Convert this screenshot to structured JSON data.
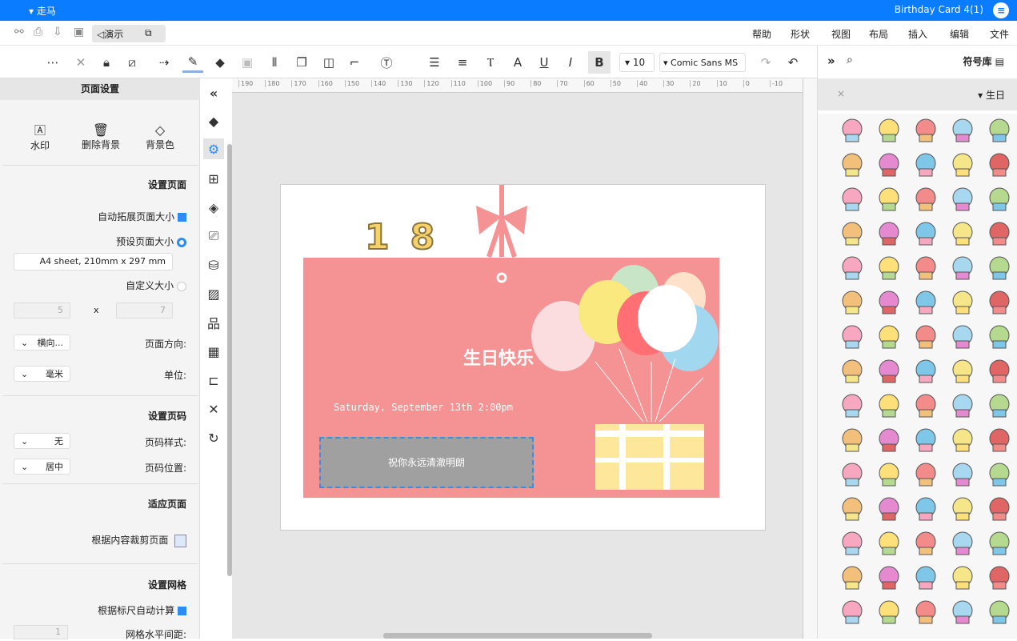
{
  "titlebar": {
    "title": "Birthday Card 4(1)",
    "user": "走马"
  },
  "menu": [
    "文件",
    "编辑",
    "插入",
    "布局",
    "视图",
    "形状",
    "帮助"
  ],
  "quick": {
    "present": "演示"
  },
  "toolbar": {
    "font": "Comic Sans MS",
    "size": "10",
    "bold": "B",
    "italic": "I",
    "underline": "U",
    "color": "A"
  },
  "left_panel": {
    "title": "页面设置",
    "actions": [
      "背景色",
      "删除背景",
      "水印"
    ],
    "page_section": "设置页面",
    "auto_extend": "自动拓展页面大小",
    "preset_size": "预设页面大小",
    "preset_value": "A4 sheet, 210mm x 297 mm",
    "custom_size": "自定义大小",
    "width": "7",
    "height": "5",
    "x": "x",
    "orientation_label": "页面方向:",
    "orientation": "横向...",
    "unit_label": "单位:",
    "unit": "毫米",
    "pagenum_section": "设置页码",
    "pagenum_style_label": "页码样式:",
    "pagenum_style": "无",
    "pagenum_pos_label": "页码位置:",
    "pagenum_pos": "居中",
    "fit_section": "适应页面",
    "fit_crop": "根据内容裁剪页面",
    "grid_section": "设置网格",
    "grid_auto": "根据标尺自动计算",
    "grid_h_label": "网格水平间距:",
    "grid_h": "1"
  },
  "ruler": [
    "-10",
    "0",
    "10",
    "20",
    "30",
    "40",
    "50",
    "60",
    "70",
    "80",
    "90",
    "100",
    "110",
    "120",
    "130",
    "140",
    "150",
    "160",
    "170",
    "180",
    "190"
  ],
  "card": {
    "title": "生日快乐",
    "date": "Saturday, September 13th 2:00pm",
    "wish": "祝你永远清澈明朗",
    "candles": "18"
  },
  "right_panel": {
    "title": "符号库",
    "category": "生日"
  },
  "colors": {
    "accent": "#0a7cff",
    "card": "#f59293",
    "textbox": "#a0a0a0"
  }
}
